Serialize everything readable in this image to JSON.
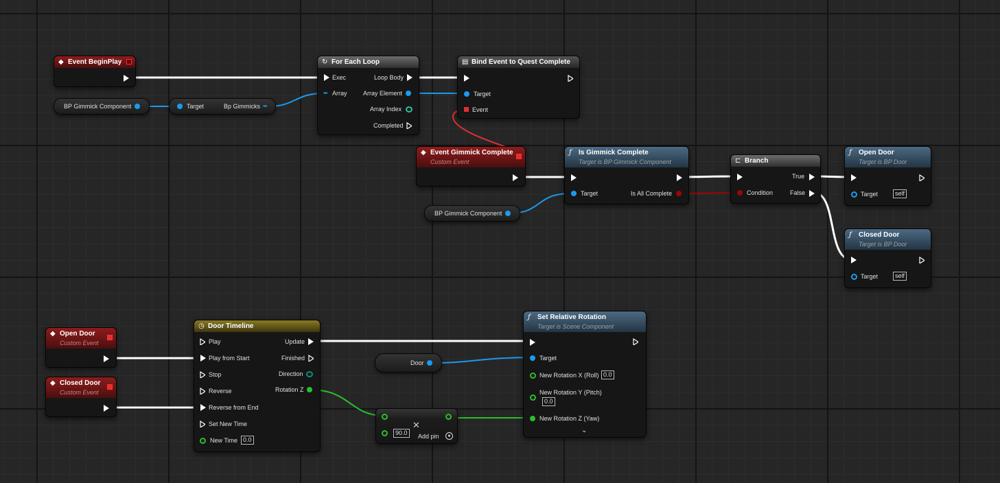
{
  "nodes": {
    "event_begin_play": {
      "title": "Event BeginPlay"
    },
    "bp_gimmick_var1": {
      "label": "BP Gimmick Component"
    },
    "get_gimmicks": {
      "target": "Target",
      "output": "Bp Gimmicks"
    },
    "for_each": {
      "title": "For Each Loop",
      "exec": "Exec",
      "array": "Array",
      "loop_body": "Loop Body",
      "array_element": "Array Element",
      "array_index": "Array Index",
      "completed": "Completed"
    },
    "bind_event": {
      "title": "Bind Event to Quest Complete",
      "target": "Target",
      "event": "Event"
    },
    "event_gimmick": {
      "title": "Event Gimmick Complete",
      "subtitle": "Custom Event"
    },
    "bp_gimmick_var2": {
      "label": "BP Gimmick Component"
    },
    "is_gimmick": {
      "title": "Is Gimmick Complete",
      "subtitle": "Target is BP Gimmick Component",
      "target": "Target",
      "output": "Is All Complete"
    },
    "branch": {
      "title": "Branch",
      "condition": "Condition",
      "true_label": "True",
      "false_label": "False"
    },
    "open_door_call": {
      "title": "Open Door",
      "subtitle": "Target is BP Door",
      "target": "Target",
      "self": "self"
    },
    "closed_door_call": {
      "title": "Closed Door",
      "subtitle": "Target is BP Door",
      "target": "Target",
      "self": "self"
    },
    "open_door_event": {
      "title": "Open Door",
      "subtitle": "Custom Event"
    },
    "closed_door_event": {
      "title": "Closed Door",
      "subtitle": "Custom Event"
    },
    "timeline": {
      "title": "Door Timeline",
      "play": "Play",
      "play_from_start": "Play from Start",
      "stop": "Stop",
      "reverse": "Reverse",
      "reverse_from_end": "Reverse from End",
      "set_new_time": "Set New Time",
      "new_time": "New Time",
      "new_time_value": "0.0",
      "update": "Update",
      "finished": "Finished",
      "direction": "Direction",
      "rotation_z": "Rotation Z"
    },
    "door_var": {
      "label": "Door"
    },
    "multiply": {
      "value": "90.0",
      "add_pin": "Add pin"
    },
    "set_rotation": {
      "title": "Set Relative Rotation",
      "subtitle": "Target is Scene Component",
      "target": "Target",
      "rot_x": "New Rotation X (Roll)",
      "rot_x_value": "0.0",
      "rot_y": "New Rotation Y (Pitch)",
      "rot_y_value": "0.0",
      "rot_z": "New Rotation Z (Yaw)"
    }
  },
  "icons": {
    "event": "diamond-icon",
    "loop": "loop-icon",
    "bind": "bind-icon",
    "function": "function-icon",
    "branch": "branch-icon",
    "timeline": "clock-icon",
    "multiply": "multiply-icon",
    "expand": "chevron-down-icon"
  },
  "colors": {
    "exec_wire": "#ffffff",
    "object_wire": "#1a9bf0",
    "float_wire": "#29c029",
    "bool_wire": "#9c0606",
    "delegate_wire": "#e03030",
    "event_header": "#8e1c1c",
    "function_header": "#4c6a83",
    "timeline_header": "#8a7a22",
    "flow_header": "#6c6c6c"
  }
}
